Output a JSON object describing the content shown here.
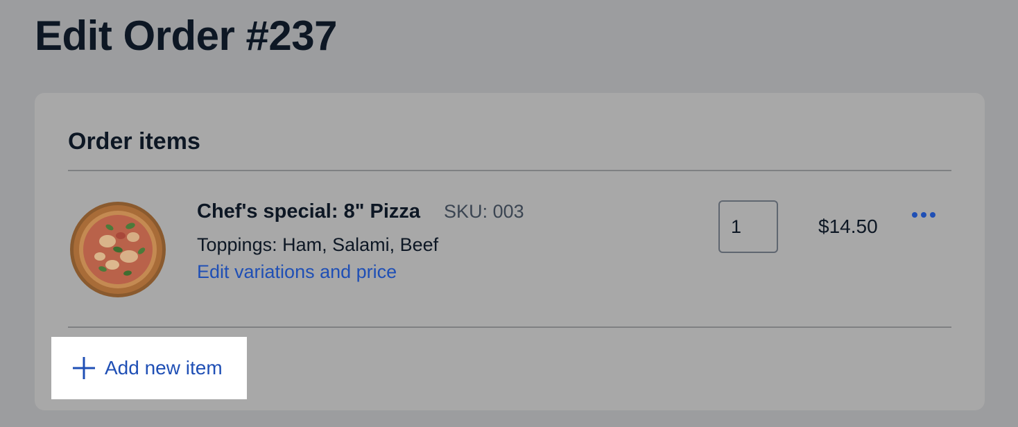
{
  "page": {
    "title": "Edit Order #237"
  },
  "order_items": {
    "heading": "Order items",
    "items": [
      {
        "image_icon": "pizza-image",
        "name": "Chef's special: 8\" Pizza",
        "sku": "SKU: 003",
        "toppings": "Toppings: Ham, Salami, Beef",
        "edit_link": "Edit variations and price",
        "quantity": "1",
        "price": "$14.50",
        "more_icon": "more-horizontal-icon"
      }
    ],
    "add_button": {
      "label": "Add new item",
      "icon": "plus-icon"
    }
  },
  "colors": {
    "link": "#1f4fb5",
    "heading": "#0d1724",
    "overlay_background": "#9c9d9f",
    "card_background": "#a8a8a8",
    "highlight_background": "#ffffff"
  }
}
